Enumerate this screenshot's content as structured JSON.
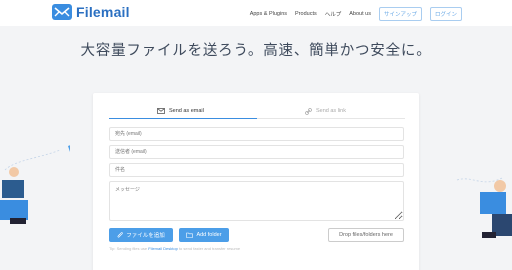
{
  "brand": {
    "name": "Filemail",
    "accent": "#3a8de0"
  },
  "nav": {
    "apps_plugins": "Apps & Plugins",
    "products": "Products",
    "help": "ヘルプ",
    "about": "About us",
    "signup": "サインアップ",
    "login": "ログイン"
  },
  "hero": {
    "title": "大容量ファイルを送ろう。高速、簡単かつ安全に。"
  },
  "form": {
    "tabs": [
      {
        "label": "Send as email",
        "icon": "envelope-icon",
        "active": true
      },
      {
        "label": "Send as link",
        "icon": "link-icon",
        "active": false
      }
    ],
    "to_placeholder": "宛先 (email)",
    "from_placeholder": "送信者 (email)",
    "subject_placeholder": "件名",
    "message_placeholder": "メッセージ",
    "add_files": "ファイルを追加",
    "add_folder": "Add folder",
    "drop_label": "Drop files/folders here",
    "hint_prefix": "Tip: Sending files use",
    "hint_link": "Filemail Desktop",
    "hint_suffix": "to send faster and transfer resume"
  }
}
